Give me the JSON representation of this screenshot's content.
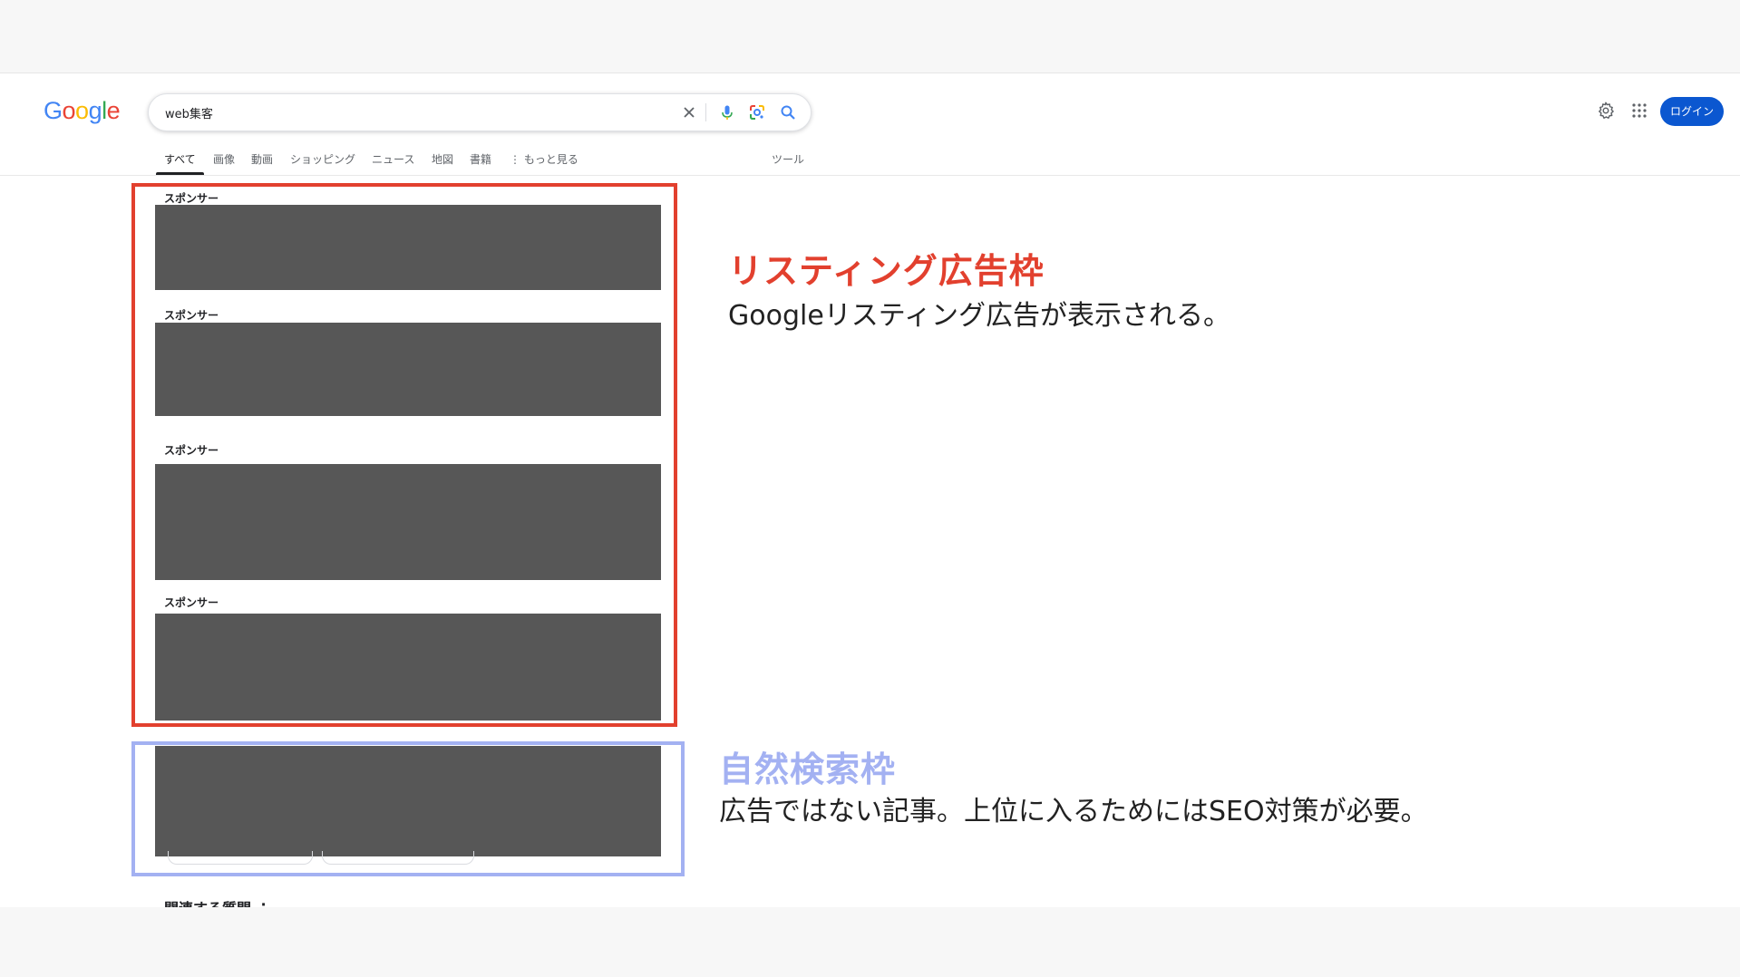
{
  "logo": {
    "text": "Google"
  },
  "search": {
    "query": "web集客"
  },
  "tabs": [
    {
      "label": "すべて"
    },
    {
      "label": "画像"
    },
    {
      "label": "動画"
    },
    {
      "label": "ショッピング"
    },
    {
      "label": "ニュース"
    },
    {
      "label": "地図"
    },
    {
      "label": "書籍"
    },
    {
      "label": "⋮ もっと見る"
    }
  ],
  "tools_label": "ツール",
  "header": {
    "login_label": "ログイン"
  },
  "results": {
    "sponsor_label": "スポンサー",
    "related_label": "関連する質問 ⋮"
  },
  "annotations": {
    "listing_title": "リスティング広告枠",
    "listing_desc": "Googleリスティング広告が表示される。",
    "organic_title": "自然検索枠",
    "organic_desc": "広告ではない記事。上位に入るためにはSEO対策が必要。"
  },
  "colors": {
    "annotation_red": "#e2402e",
    "annotation_blue": "#a3b1f2",
    "placeholder_gray": "#575757",
    "login_blue": "#0b57d0"
  }
}
